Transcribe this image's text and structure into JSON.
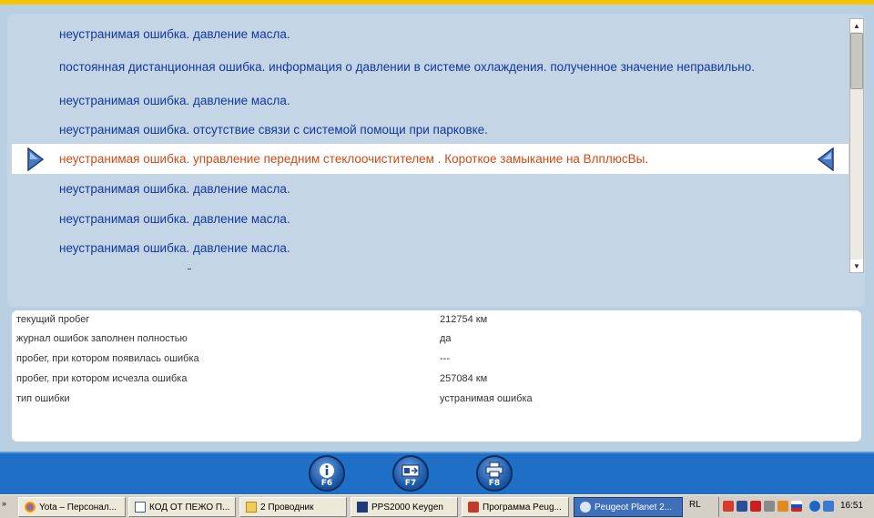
{
  "faults": [
    {
      "text": "неустранимая ошибка. давление масла.",
      "selected": false
    },
    {
      "text": "постоянная дистанционная ошибка. информация о давлении в системе охлаждения. полученное значение неправильно.",
      "selected": false
    },
    {
      "text": "неустранимая ошибка. давление масла.",
      "selected": false
    },
    {
      "text": "неустранимая ошибка. отсутствие связи с системой помощи при парковке.",
      "selected": false
    },
    {
      "text": "неустранимая ошибка. управление передним стеклоочистителем . Короткое замыкание на ВлплюсВы.",
      "selected": true
    },
    {
      "text": "неустранимая ошибка. давление масла.",
      "selected": false
    },
    {
      "text": "неустранимая ошибка. давление масла.",
      "selected": false
    },
    {
      "text": "неустранимая ошибка. давление масла.",
      "selected": false
    }
  ],
  "details": [
    {
      "label": "текущий пробег",
      "value": "212754 км"
    },
    {
      "label": "журнал ошибок заполнен полностью",
      "value": "да"
    },
    {
      "label": "пробег, при котором появилась ошибка",
      "value": "---"
    },
    {
      "label": "пробег, при котором исчезла ошибка",
      "value": "257084 км"
    },
    {
      "label": "тип ошибки",
      "value": "устранимая ошибка"
    }
  ],
  "toolbar": {
    "buttons": [
      {
        "label": "F6",
        "icon": "info-icon"
      },
      {
        "label": "F7",
        "icon": "document-transfer-icon"
      },
      {
        "label": "F8",
        "icon": "printer-icon"
      }
    ]
  },
  "taskbar": {
    "tasks": [
      {
        "label": "Yota – Персонал...",
        "icon": "chrome-icon",
        "active": false
      },
      {
        "label": "КОД ОТ ПЕЖО П...",
        "icon": "window-icon",
        "active": false
      },
      {
        "label": "2 Проводник",
        "icon": "folder-icon",
        "active": false
      },
      {
        "label": "PPS2000 Keygen",
        "icon": "app-icon",
        "active": false
      },
      {
        "label": "Программа Peug...",
        "icon": "program-icon",
        "active": false
      },
      {
        "label": "Peugeot Planet 2...",
        "icon": "planet-icon",
        "active": true
      }
    ],
    "language": "RL",
    "clock": "16:51"
  },
  "colors": {
    "topbar": "#f5c400",
    "background": "#b9cfe2",
    "fault_text": "#14389a",
    "selected_text": "#d24a14",
    "toolbar": "#1f6fc6"
  }
}
